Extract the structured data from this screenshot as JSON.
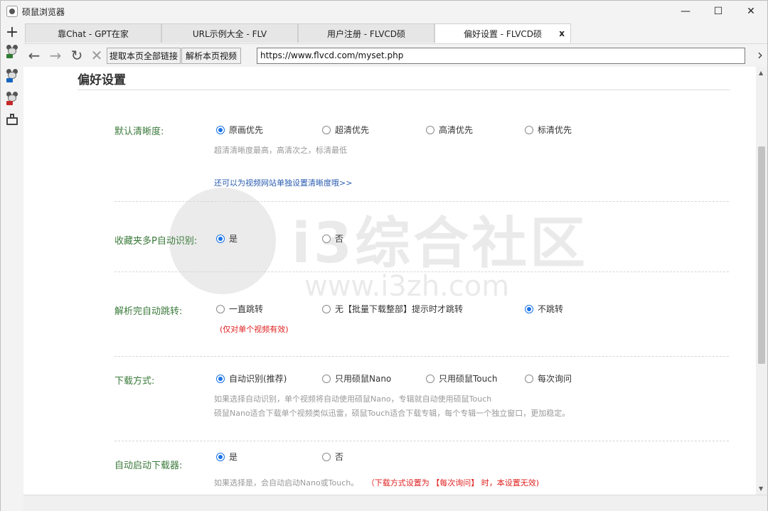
{
  "window": {
    "title": "硕鼠浏览器",
    "minimize": "—",
    "maximize": "☐",
    "close": "✕"
  },
  "lefttool": {
    "add": "+"
  },
  "tabs": [
    {
      "label": "靠Chat - GPT在家"
    },
    {
      "label": "URL示例大全 - FLV"
    },
    {
      "label": "用户注册 - FLVCD硕"
    },
    {
      "label": "偏好设置 - FLVCD硕",
      "close": "x"
    }
  ],
  "nav": {
    "back": "←",
    "forward": "→",
    "reload": "↻",
    "stop": "✕",
    "extract_links": "提取本页全部链接",
    "parse_video": "解析本页视频",
    "url": "https://www.flvcd.com/myset.php",
    "go": "›"
  },
  "watermark": {
    "text": "i3综合社区",
    "sub": "www.i3zh.com"
  },
  "page": {
    "title": "偏好设置",
    "sections": {
      "quality": {
        "label": "默认清晰度:",
        "options": [
          "原画优先",
          "超清优先",
          "高清优先",
          "标清优先"
        ],
        "note": "超清清晰度最高，高清次之，标清最低",
        "link": "还可以为视频网站单独设置清晰度哦>>"
      },
      "multi_p": {
        "label": "收藏夹多P自动识别:",
        "options": [
          "是",
          "否"
        ]
      },
      "auto_jump": {
        "label": "解析完自动跳转:",
        "options": [
          "一直跳转",
          "无【批量下载整部】提示时才跳转",
          "不跳转"
        ],
        "note": "(仅对单个视频有效)"
      },
      "download_mode": {
        "label": "下载方式:",
        "options": [
          "自动识别(推荐)",
          "只用硕鼠Nano",
          "只用硕鼠Touch",
          "每次询问"
        ],
        "note1": "如果选择自动识别，单个视频将自动使用硕鼠Nano，专辑就自动使用硕鼠Touch",
        "note2": "硕鼠Nano适合下载单个视频类似迅雷，硕鼠Touch适合下载专辑，每个专辑一个独立窗口，更加稳定。"
      },
      "auto_start": {
        "label": "自动启动下载器:",
        "options": [
          "是",
          "否"
        ],
        "note_main": "如果选择是，会自动启动Nano或Touch。",
        "note_red": "（下载方式设置为 【每次询问】 时，本设置无效)"
      }
    }
  },
  "colors": {
    "label_green": "#3b7a3b",
    "radio_blue": "#1a73e8",
    "warning_red": "#e02020",
    "link_blue": "#2a5db0"
  }
}
